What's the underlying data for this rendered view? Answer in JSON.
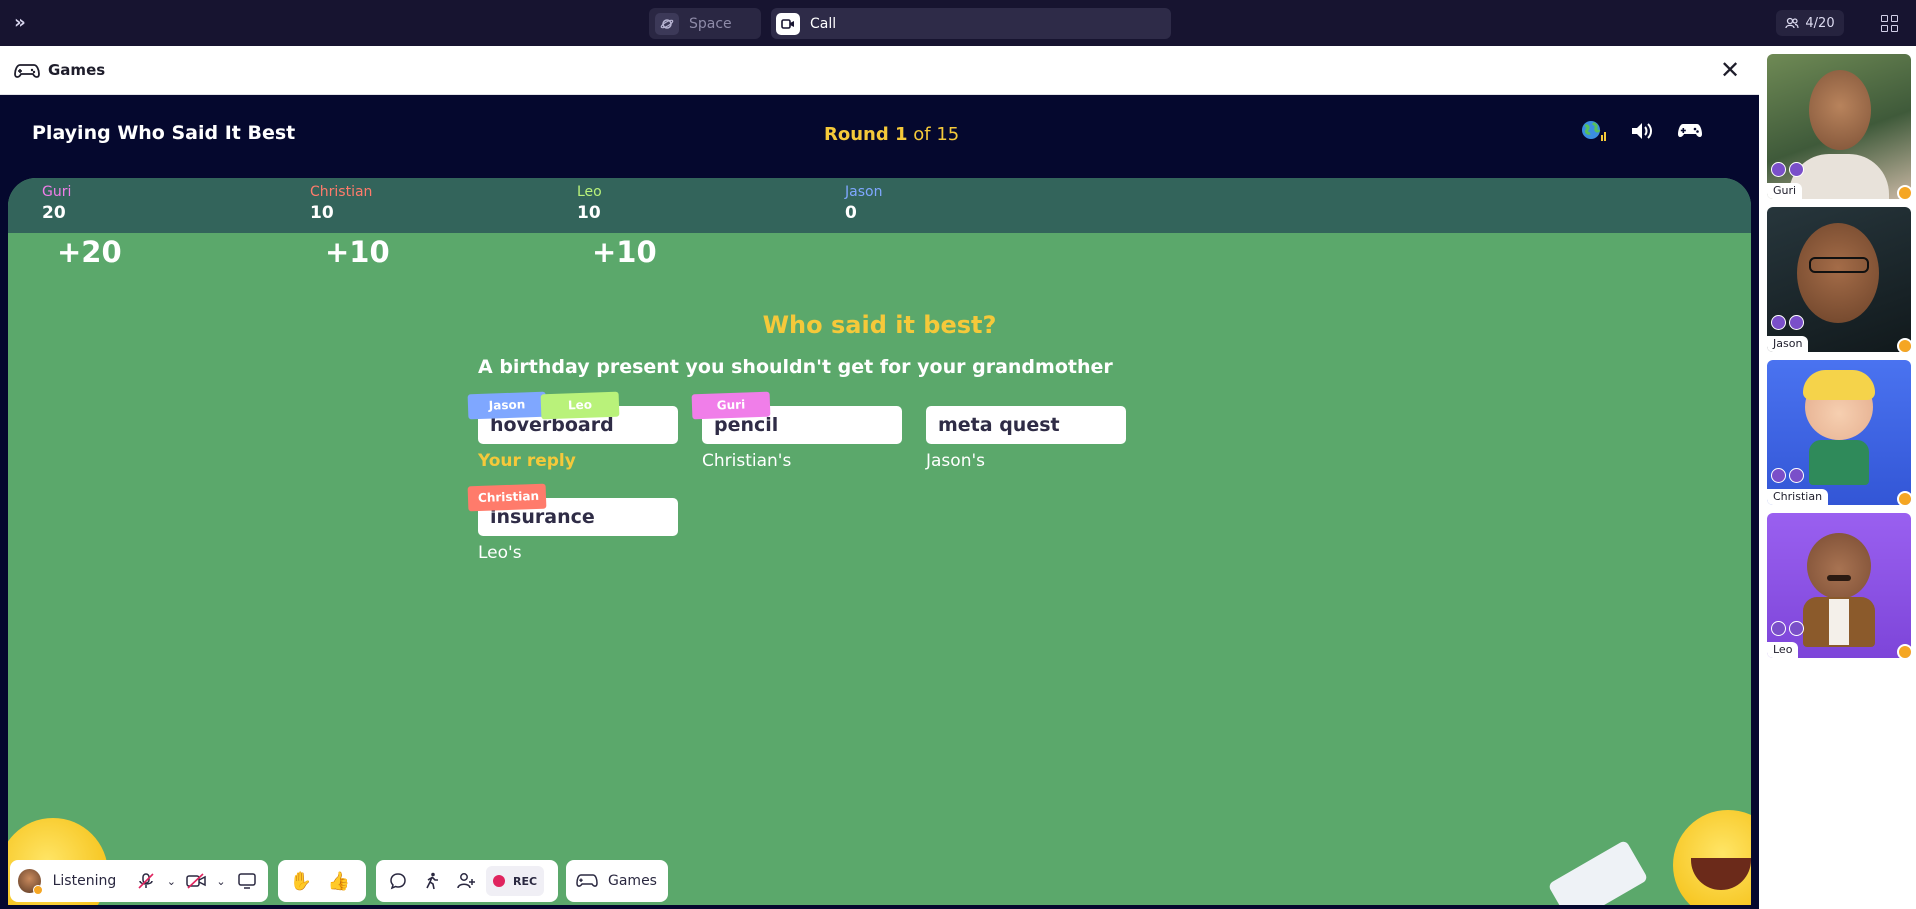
{
  "topbar": {
    "space_label": "Space",
    "call_label": "Call",
    "people_count": "4/20"
  },
  "panel": {
    "title": "Games"
  },
  "game": {
    "title": "Playing Who Said It Best",
    "round_label": "Round 1",
    "round_of": "of 15",
    "scores": [
      {
        "name": "Guri",
        "points": "20",
        "delta": "+20",
        "color": "#f07ee9"
      },
      {
        "name": "Christian",
        "points": "10",
        "delta": "+10",
        "color": "#ff7b6b"
      },
      {
        "name": "Leo",
        "points": "10",
        "delta": "+10",
        "color": "#b9f27a"
      },
      {
        "name": "Jason",
        "points": "0",
        "delta": "",
        "color": "#7fa7ff"
      }
    ],
    "question_heading": "Who said it best?",
    "prompt": "A birthday present you shouldn't get for your grandmother",
    "answers": [
      {
        "text": "hoverboard",
        "owner": "Your reply",
        "owner_color": "#f5c93a",
        "votes": [
          "Jason",
          "Leo"
        ]
      },
      {
        "text": "pencil",
        "owner": "Christian's",
        "owner_color": "#ffffff",
        "votes": [
          "Guri"
        ]
      },
      {
        "text": "meta quest",
        "owner": "Jason's",
        "owner_color": "#ffffff",
        "votes": []
      },
      {
        "text": "insurance",
        "owner": "Leo's",
        "owner_color": "#ffffff",
        "votes": [
          "Christian"
        ]
      }
    ],
    "vote_colors": {
      "Jason": "#7fa7ff",
      "Leo": "#b9f27a",
      "Guri": "#f07ee9",
      "Christian": "#ff7b6b"
    }
  },
  "toolbar": {
    "status_label": "Listening",
    "rec_label": "REC",
    "games_label": "Games"
  },
  "participants": [
    {
      "name": "Guri"
    },
    {
      "name": "Jason"
    },
    {
      "name": "Christian"
    },
    {
      "name": "Leo"
    }
  ]
}
